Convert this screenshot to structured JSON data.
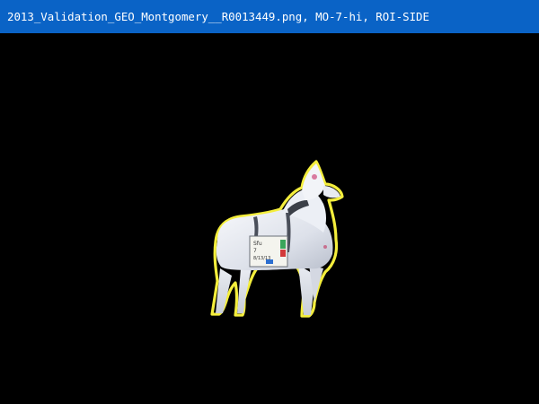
{
  "window": {
    "title": "2013_Validation_GEO_Montgomery__R0013449.png, MO-7-hi, ROI-SIDE"
  },
  "colors": {
    "titlebar_bg": "#0a63c6",
    "canvas_bg": "#000000",
    "roi_outline": "#f4ee3c"
  },
  "tag_text": {
    "line1": "Sfu",
    "line2": "7",
    "line3": "8/13/13"
  }
}
